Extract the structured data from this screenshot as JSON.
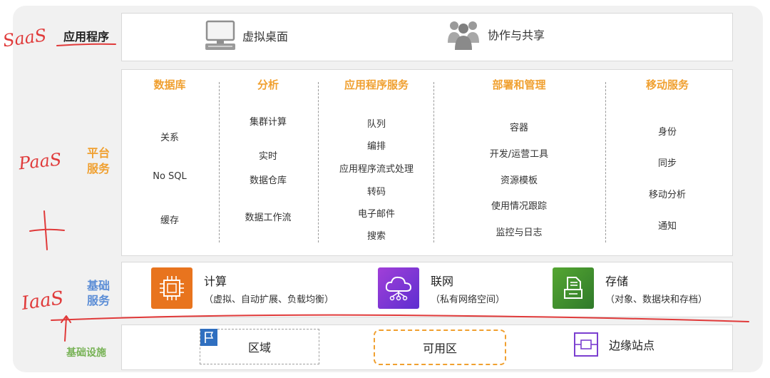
{
  "rows": {
    "saas": {
      "label": "应用程序",
      "items": [
        {
          "label": "虚拟桌面",
          "icon": "desktop-icon"
        },
        {
          "label": "协作与共享",
          "icon": "people-group-icon"
        }
      ]
    },
    "paas": {
      "label_line1": "平台",
      "label_line2": "服务",
      "columns": [
        {
          "title": "数据库",
          "items": [
            "关系",
            "No SQL",
            "缓存"
          ]
        },
        {
          "title": "分析",
          "items": [
            "集群计算",
            "实时",
            "数据仓库",
            "数据工作流"
          ]
        },
        {
          "title": "应用程序服务",
          "items": [
            "队列",
            "编排",
            "应用程序流式处理",
            "转码",
            "电子邮件",
            "搜索"
          ]
        },
        {
          "title": "部署和管理",
          "items": [
            "容器",
            "开发/运营工具",
            "资源模板",
            "使用情况跟踪",
            "监控与日志"
          ]
        },
        {
          "title": "移动服务",
          "items": [
            "身份",
            "同步",
            "移动分析",
            "通知"
          ]
        }
      ]
    },
    "iaas": {
      "label_line1": "基础",
      "label_line2": "服务",
      "items": [
        {
          "name": "计算",
          "sub": "（虚拟、自动扩展、负载均衡）",
          "icon": "chip-icon",
          "color": "#e8741e"
        },
        {
          "name": "联网",
          "sub": "（私有网络空间）",
          "icon": "cloud-network-icon",
          "color": "#7b3fd0"
        },
        {
          "name": "存储",
          "sub": "（对象、数据块和存档）",
          "icon": "storage-bucket-icon",
          "color": "#3f8a2a"
        }
      ]
    },
    "infra": {
      "label": "基础设施",
      "items": [
        {
          "label": "区域",
          "icon": "flag-icon"
        },
        {
          "label": "可用区"
        },
        {
          "label": "边缘站点",
          "icon": "edge-location-icon"
        }
      ]
    }
  },
  "annotations": {
    "saas": "SaaS",
    "paas": "PaaS",
    "iaas": "IaaS"
  },
  "colors": {
    "paas_label": "#f0a030",
    "iaas_label": "#5b8dd6",
    "infra_label": "#77b255",
    "annotation_red": "#e03a3a"
  }
}
